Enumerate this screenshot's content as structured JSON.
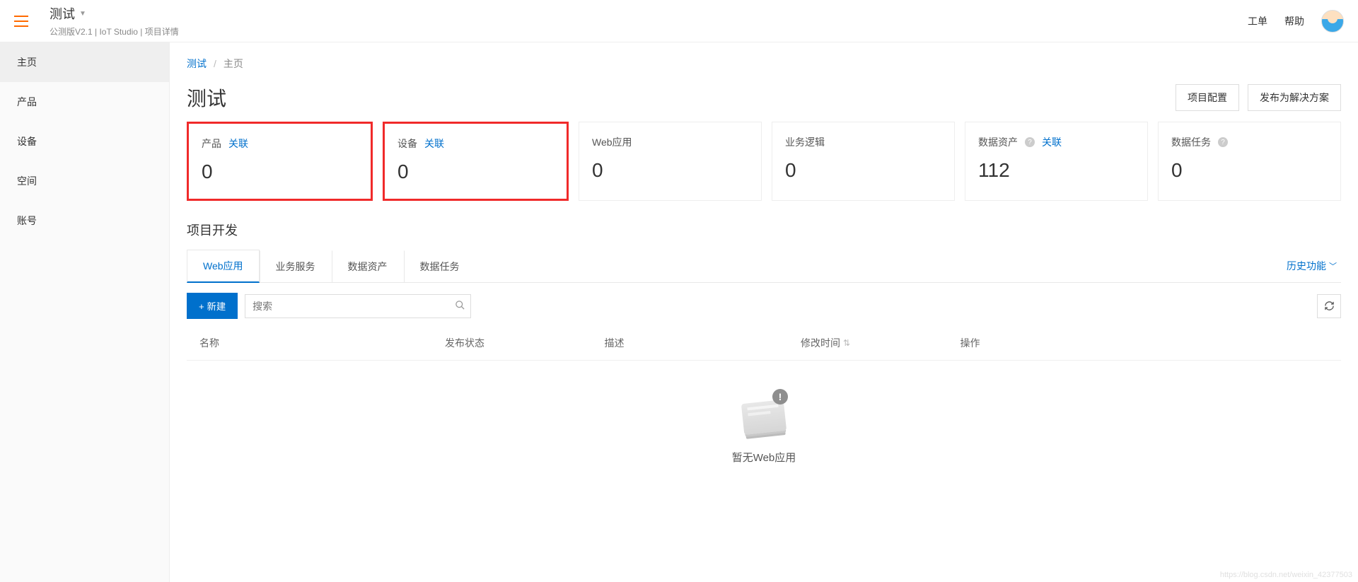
{
  "header": {
    "title": "测试",
    "subtitle": "公测版V2.1 | IoT Studio | 项目详情",
    "links": {
      "ticket": "工单",
      "help": "帮助"
    }
  },
  "sidebar": {
    "items": [
      {
        "label": "主页",
        "active": true
      },
      {
        "label": "产品",
        "active": false
      },
      {
        "label": "设备",
        "active": false
      },
      {
        "label": "空间",
        "active": false
      },
      {
        "label": "账号",
        "active": false
      }
    ]
  },
  "breadcrumb": {
    "root": "测试",
    "current": "主页",
    "sep": "/"
  },
  "page": {
    "title": "测试",
    "config_btn": "项目配置",
    "publish_btn": "发布为解决方案"
  },
  "stats": [
    {
      "label": "产品",
      "link": "关联",
      "value": "0",
      "highlight": true,
      "help": false
    },
    {
      "label": "设备",
      "link": "关联",
      "value": "0",
      "highlight": true,
      "help": false
    },
    {
      "label": "Web应用",
      "link": "",
      "value": "0",
      "highlight": false,
      "help": false
    },
    {
      "label": "业务逻辑",
      "link": "",
      "value": "0",
      "highlight": false,
      "help": false
    },
    {
      "label": "数据资产",
      "link": "关联",
      "value": "112",
      "highlight": false,
      "help": true
    },
    {
      "label": "数据任务",
      "link": "",
      "value": "0",
      "highlight": false,
      "help": true
    }
  ],
  "section": {
    "title": "项目开发",
    "tabs": [
      {
        "label": "Web应用",
        "active": true
      },
      {
        "label": "业务服务",
        "active": false
      },
      {
        "label": "数据资产",
        "active": false
      },
      {
        "label": "数据任务",
        "active": false
      }
    ],
    "history": "历史功能"
  },
  "toolbar": {
    "new_btn": "+ 新建",
    "search_placeholder": "搜索"
  },
  "table": {
    "cols": {
      "name": "名称",
      "status": "发布状态",
      "desc": "描述",
      "time": "修改时间",
      "ops": "操作"
    }
  },
  "empty": {
    "text": "暂无Web应用"
  },
  "watermark": "https://blog.csdn.net/weixin_42377503"
}
